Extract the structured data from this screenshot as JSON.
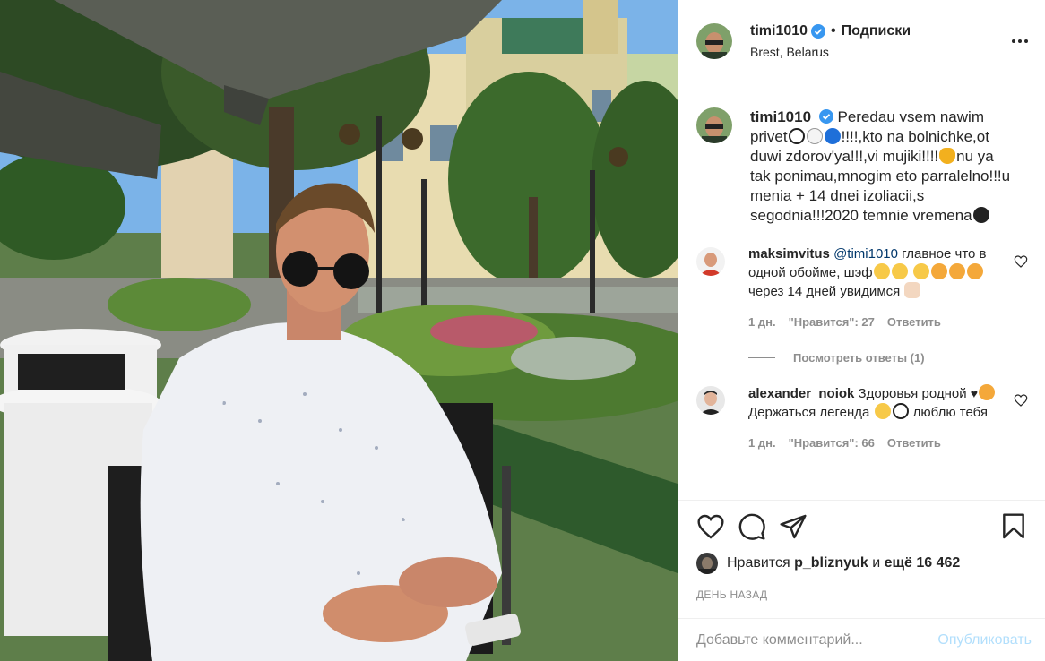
{
  "post": {
    "username": "timi1010",
    "separator": "•",
    "follow_label": "Подписки",
    "location": "Brest, Belarus"
  },
  "caption": {
    "username": "timi1010",
    "part1": "Peredau vsem nawim privet",
    "part2": "!!!!,kto na bolnichke,ot duwi zdorov'ya!!!,vi mujiki!!!!",
    "part3": "nu ya tak ponimau,mnogim eto parralelno!!!u menia + 14 dnei izoliacii,s segodnia!!!2020 temnie vremena"
  },
  "comments": [
    {
      "username": "maksimvitus",
      "mention": "@timi1010",
      "text1": " главное что в одной обойме, шэф",
      "text2": " через 14 дней увидимся",
      "age": "1 дн.",
      "likes": "\"Нравится\": 27",
      "reply": "Ответить",
      "view_replies": "Посмотреть ответы (1)"
    },
    {
      "username": "alexander_noiok",
      "text1": " Здоровья родной ",
      "text2": " Держаться легенда",
      "text3": "люблю тебя",
      "age": "1 дн.",
      "likes": "\"Нравится\": 66",
      "reply": "Ответить"
    }
  ],
  "likes_line": {
    "prefix": "Нравится",
    "user": "p_bliznyuk",
    "middle": "и",
    "rest": "ещё 16 462"
  },
  "timestamp": "ДЕНЬ НАЗАД",
  "add_comment": {
    "placeholder": "Добавьте комментарий...",
    "publish": "Опубликовать"
  },
  "icons": {
    "more": "more-options-icon",
    "like": "heart-icon",
    "comment": "comment-icon",
    "share": "share-icon",
    "save": "bookmark-icon",
    "verified": "verified-badge-icon"
  },
  "colors": {
    "verified": "#3897f0",
    "publish_disabled": "#b2dffc",
    "meta_gray": "#8e8e8e",
    "mention": "#00376b"
  }
}
